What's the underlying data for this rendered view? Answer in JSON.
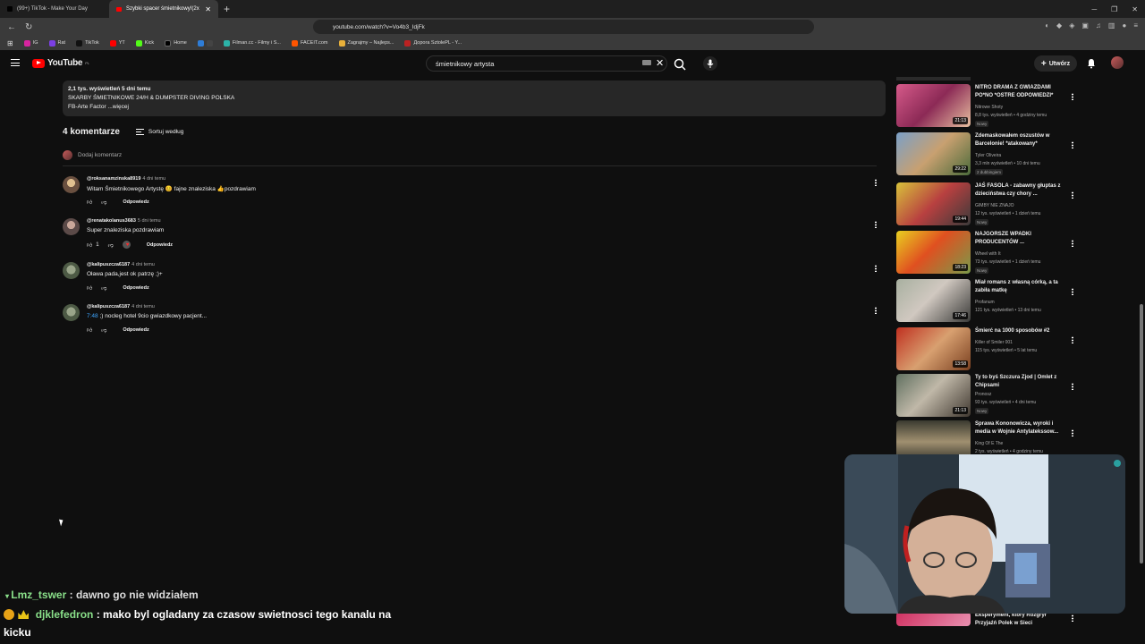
{
  "browser": {
    "tabs": [
      {
        "title": "(99+) TikTok - Make Your Day",
        "active": false
      },
      {
        "title": "Szybki spacer śmietnikowy!(2x",
        "active": true
      }
    ],
    "url": "youtube.com/watch?v=Vo4b3_IdjFk",
    "bookmarks": [
      "IG",
      "Rat",
      "TikTok",
      "YT",
      "Kick",
      "Home",
      "",
      "Filman.cc - Filmy i S...",
      "FACEIT.com",
      "Zagrajmy – Najleps...",
      "Дорога SztolePL - Y..."
    ]
  },
  "youtube": {
    "logo_text": "YouTube",
    "logo_region": "PL",
    "search_value": "śmietnikowy artysta",
    "create_label": "Utwórz"
  },
  "description": {
    "meta": "2,1 tys. wyświetleń  5 dni temu",
    "line1": "SKARBY ŚMIETNIKOWE 24/H  &  DUMPSTER DIVING POLSKA",
    "line2": "FB-Arte Factor ...więcej"
  },
  "comments_section": {
    "count_label": "4 komentarze",
    "sort_label": "Sortuj według",
    "add_placeholder": "Dodaj komentarz",
    "reply_label": "Odpowiedz",
    "items": [
      {
        "author": "@roksanamzinska8919",
        "time": "4 dni temu",
        "text": "Witam Śmietnikowego Artystę 😊 fajne znaleziska 👍pozdrawiam",
        "likes": ""
      },
      {
        "author": "@renatakolanus3683",
        "time": "5 dni temu",
        "text": "Super znaleziska pozdrawiam",
        "likes": "1"
      },
      {
        "author": "@kalipuszcza6187",
        "time": "4 dni temu",
        "text": "Oława pada,jest ok patrzę ;)+",
        "likes": ""
      },
      {
        "author": "@kalipuszcza6187",
        "time": "4 dni temu",
        "timestamp": "7:48",
        "text": " ;) nocleg hotel 9cio gwiazdkowy pacjent...",
        "likes": ""
      }
    ]
  },
  "sidebar": {
    "items": [
      {
        "title": "NITRO DRAMA Z GWIAZDAMI PO*NO *OSTRE ODPOWIEDZI*",
        "channel": "Nitrowe Shoty",
        "meta": "8,8 tys. wyświetleń • 4 godziny temu",
        "badge": "Nowy",
        "duration": "21:13"
      },
      {
        "title": "Zdemaskowałem oszustów w Barcelonie! *atakowany*",
        "channel": "Tyler Oliveira",
        "meta": "3,3 mln wyświetleń • 10 dni temu",
        "badge": "2 dubbingiem",
        "duration": "29:22"
      },
      {
        "title": "JAŚ FASOLA - zabawny głuptas z dzieciństwa czy chory ...",
        "channel": "GIMBY NIE ZNAJO",
        "meta": "12 tys. wyświetleń • 1 dzień temu",
        "badge": "Nowy",
        "duration": "19:44"
      },
      {
        "title": "NAJGORSZE WPADKI PRODUCENTÓW ...",
        "channel": "Wheel with It",
        "meta": "73 tys. wyświetleń • 1 dzień temu",
        "badge": "Nowy",
        "duration": "18:23"
      },
      {
        "title": "Miał romans z własną córką, a ta zabiła matkę",
        "channel": "Profanum",
        "meta": "121 tys. wyświetleń • 13 dni temu",
        "badge": "",
        "duration": "17:46"
      },
      {
        "title": "Śmierć na 1000 sposobów #2",
        "channel": "Killer of Smiler 001",
        "meta": "115 tys. wyświetleń • 5 lat temu",
        "badge": "",
        "duration": "13:58"
      },
      {
        "title": "Ty to byś Szczura Zjod | Omlet z Chipsami",
        "channel": "Pronosz",
        "meta": "93 tys. wyświetleń • 4 dni temu",
        "badge": "Nowy",
        "duration": "21:13"
      },
      {
        "title": "Sprawa Kononowicza, wyroki i media w Wojnie Antylatekssow...",
        "channel": "King Of E The",
        "meta": "2 tys. wyświetleń • 4 godziny temu",
        "badge": "",
        "duration": ""
      },
      {
        "title": "Eksperyment, który Rozgrył Przyjaźń Polek w Sieci",
        "channel": "",
        "meta": "",
        "badge": "",
        "duration": ""
      }
    ]
  },
  "chat": {
    "line1_user": "Lmz_tswer",
    "line1_text": ": dawno go nie widziałem",
    "line2_user": "djklefedron",
    "line2_text": ": mako byl ogladany za czasow swietnosci tego kanalu na",
    "line3_text": "kicku"
  }
}
